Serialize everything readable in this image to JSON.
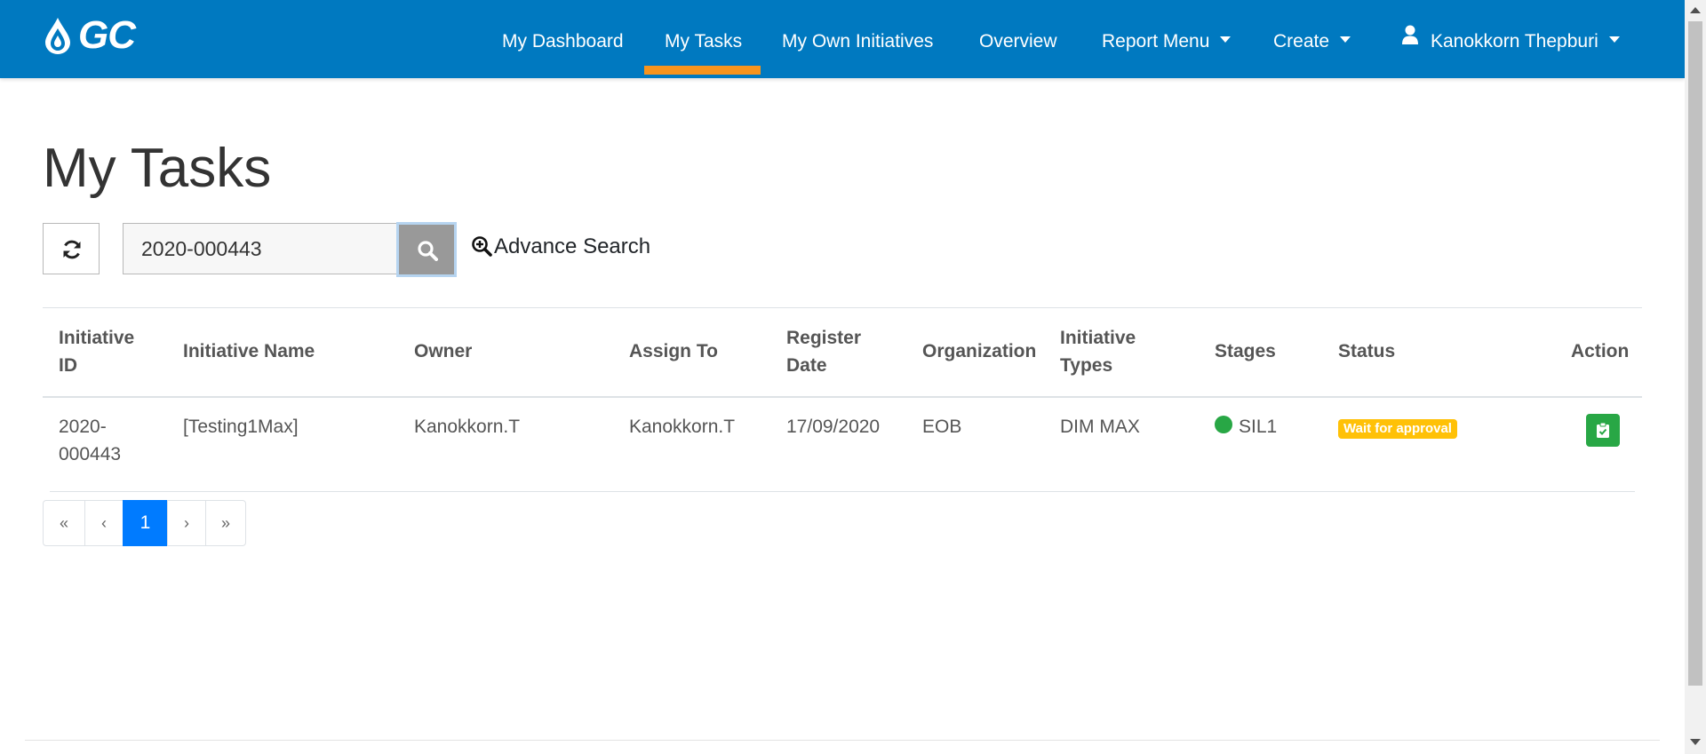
{
  "brand": {
    "logo_text": "GC",
    "accent": "#f7941d",
    "navbar_color": "#0079c0"
  },
  "nav": {
    "items": [
      {
        "label": "My Dashboard"
      },
      {
        "label": "My Tasks",
        "active": true
      },
      {
        "label": "My Own Initiatives"
      },
      {
        "label": "Overview"
      },
      {
        "label": "Report Menu",
        "dropdown": true
      },
      {
        "label": "Create",
        "dropdown": true
      }
    ],
    "user": {
      "name": "Kanokkorn Thepburi",
      "icon": "user-icon",
      "dropdown": true
    }
  },
  "page": {
    "title": "My Tasks"
  },
  "toolbar": {
    "refresh_icon": "refresh-icon",
    "search_value": "2020-000443",
    "search_icon": "search-icon",
    "advance_search_label": "Advance Search",
    "advance_search_icon": "zoom-in-icon"
  },
  "table": {
    "headers": {
      "initiative_id": [
        "Initiative",
        "ID"
      ],
      "initiative_name": "Initiative Name",
      "owner": "Owner",
      "assign_to": "Assign To",
      "register_date": [
        "Register",
        "Date"
      ],
      "organization": "Organization",
      "initiative_types": [
        "Initiative",
        "Types"
      ],
      "stages": "Stages",
      "status": "Status",
      "action": "Action"
    },
    "rows": [
      {
        "initiative_id": [
          "2020-",
          "000443"
        ],
        "initiative_name": "[Testing1Max]",
        "owner": "Kanokkorn.T",
        "assign_to": "Kanokkorn.T",
        "register_date": "17/09/2020",
        "organization": "EOB",
        "initiative_types": "DIM MAX",
        "stage": "SIL1",
        "stage_color": "#28a745",
        "status": "Wait for approval",
        "status_color": "#ffc107",
        "action_icon": "clipboard-check-icon"
      }
    ]
  },
  "pagination": {
    "first": "«",
    "prev": "‹",
    "pages": [
      "1"
    ],
    "current": "1",
    "next": "›",
    "last": "»"
  }
}
